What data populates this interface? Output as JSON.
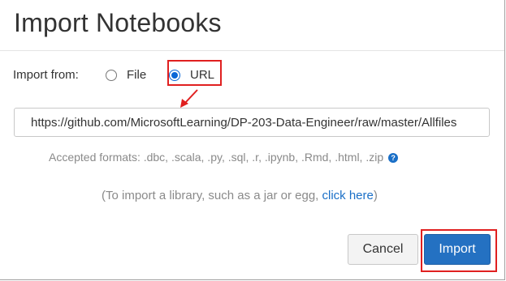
{
  "dialog": {
    "title": "Import Notebooks",
    "import_from_label": "Import from:",
    "options": [
      {
        "label": "File",
        "selected": false
      },
      {
        "label": "URL",
        "selected": true
      }
    ],
    "url_value": "https://github.com/MicrosoftLearning/DP-203-Data-Engineer/raw/master/Allfiles",
    "accepted_formats": "Accepted formats: .dbc, .scala, .py, .sql, .r, .ipynb, .Rmd, .html, .zip",
    "help_icon": "question-circle-icon",
    "library_prefix": "(To import a library, such as a jar or egg, ",
    "library_link": "click here",
    "library_suffix": ")",
    "cancel_label": "Cancel",
    "import_label": "Import"
  },
  "colors": {
    "accent": "#2471c2",
    "annotation": "#e02020",
    "link": "#1a6fc7"
  }
}
